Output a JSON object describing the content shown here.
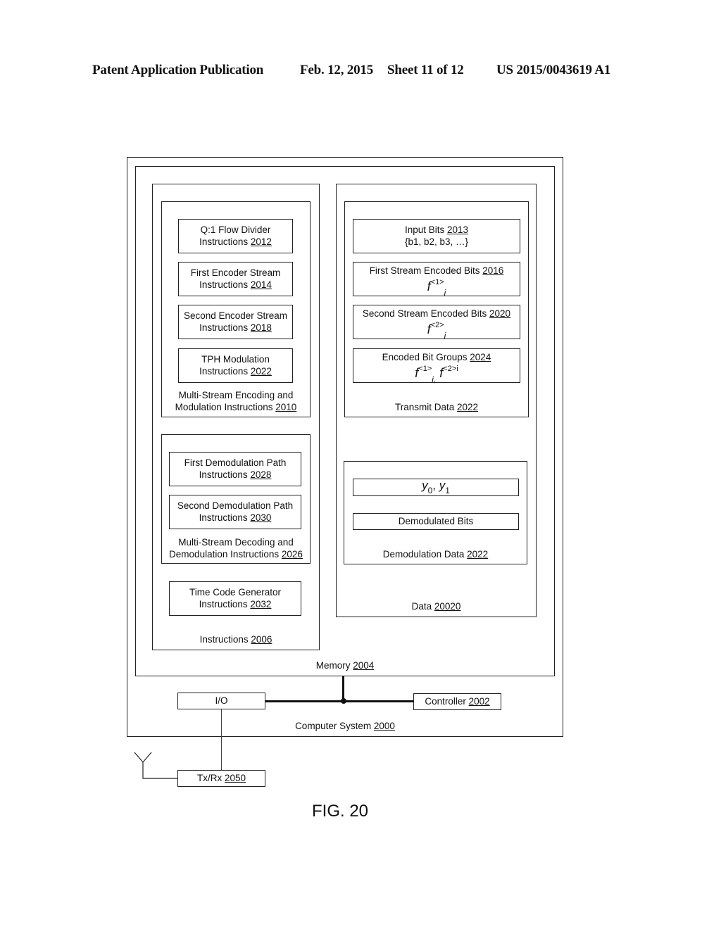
{
  "header": {
    "publication": "Patent Application Publication",
    "date": "Feb. 12, 2015",
    "sheet": "Sheet 11 of 12",
    "patent_number": "US 2015/0043619 A1"
  },
  "figure_label": "FIG. 20",
  "computer_system": {
    "label": "Computer System",
    "ref": "2000"
  },
  "memory": {
    "label": "Memory",
    "ref": "2004"
  },
  "instructions": {
    "label": "Instructions",
    "ref": "2006",
    "encoding_group": {
      "label_line1": "Multi-Stream Encoding and",
      "label_line2": "Modulation Instructions",
      "ref": "2010",
      "items": [
        {
          "line1": "Q:1 Flow Divider",
          "line2": "Instructions",
          "ref": "2012"
        },
        {
          "line1": "First Encoder Stream",
          "line2": "Instructions",
          "ref": "2014"
        },
        {
          "line1": "Second Encoder Stream",
          "line2": "Instructions",
          "ref": "2018"
        },
        {
          "line1": "TPH Modulation",
          "line2": "Instructions",
          "ref": "2022"
        }
      ]
    },
    "decoding_group": {
      "label_line1": "Multi-Stream Decoding and",
      "label_line2": "Demodulation Instructions",
      "ref": "2026",
      "items": [
        {
          "line1": "First Demodulation Path",
          "line2": "Instructions",
          "ref": "2028"
        },
        {
          "line1": "Second Demodulation Path",
          "line2": "Instructions",
          "ref": "2030"
        }
      ]
    },
    "time_code": {
      "line1": "Time Code Generator",
      "line2": "Instructions",
      "ref": "2032"
    }
  },
  "data": {
    "label": "Data",
    "ref": "20020",
    "transmit": {
      "label": "Transmit Data",
      "ref": "2022",
      "items": [
        {
          "title": "Input Bits",
          "ref": "2013",
          "formula": "{b1, b2, b3, …}"
        },
        {
          "title": "First Stream Encoded Bits",
          "ref": "2016",
          "f": "f",
          "sup": "<1>",
          "sub": "i"
        },
        {
          "title": "Second Stream Encoded Bits",
          "ref": "2020",
          "f": "f",
          "sup": "<2>",
          "sub": "i"
        },
        {
          "title": "Encoded Bit Groups",
          "ref": "2024",
          "f": "f",
          "sup": "<1>",
          "sub": "i,",
          "f2": "f",
          "sup2": "<2>i"
        }
      ]
    },
    "demodulation": {
      "label": "Demodulation Data",
      "ref": "2022",
      "y_symbol": "y",
      "y0_sub": "0",
      "sep": ", ",
      "y1_sub": "1",
      "bits_label": "Demodulated Bits"
    }
  },
  "io": {
    "label": "I/O"
  },
  "controller": {
    "label": "Controller",
    "ref": "2002"
  },
  "txrx": {
    "label": "Tx/Rx",
    "ref": "2050"
  }
}
